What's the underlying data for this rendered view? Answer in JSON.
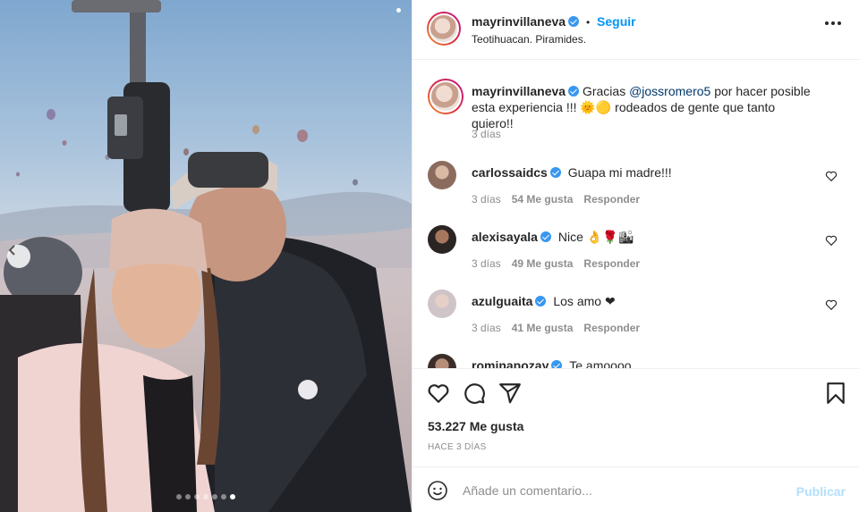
{
  "post": {
    "username": "mayrinvillaneva",
    "follow_label": "Seguir",
    "location": "Teotihuacan. Piramides.",
    "bullet": "•"
  },
  "caption": {
    "username": "mayrinvillaneva",
    "text_before": "Gracias ",
    "mention": "@jossromero5",
    "text_after": " por hacer posible esta experiencia !!! 🌞🟡 rodeados de gente que tanto quiero!!",
    "time": "3 días"
  },
  "comments": [
    {
      "username": "carlossaidcs",
      "text": "Guapa mi madre!!!",
      "time": "3 días",
      "likes": "54 Me gusta",
      "reply": "Responder"
    },
    {
      "username": "alexisayala",
      "text": "Nice 👌🌹🏙",
      "time": "3 días",
      "likes": "49 Me gusta",
      "reply": "Responder"
    },
    {
      "username": "azulguaita",
      "text": "Los amo ❤",
      "time": "3 días",
      "likes": "41 Me gusta",
      "reply": "Responder"
    },
    {
      "username": "rominapozay",
      "text": "Te amoooo",
      "time": "",
      "likes": "",
      "reply": ""
    }
  ],
  "footer": {
    "likes": "53.227 Me gusta",
    "ago": "HACE 3 DÍAS",
    "comment_placeholder": "Añade un comentario...",
    "publish_label": "Publicar"
  },
  "carousel": {
    "count": 7,
    "active": 6
  },
  "colors": {
    "accent": "#0095f6",
    "verified": "#3897f0",
    "publish_disabled": "#b2dffc"
  },
  "icons": [
    "heart-icon",
    "comment-icon",
    "share-icon",
    "bookmark-icon",
    "emoji-icon",
    "more-icon",
    "chevron-left-icon",
    "verified-icon"
  ]
}
